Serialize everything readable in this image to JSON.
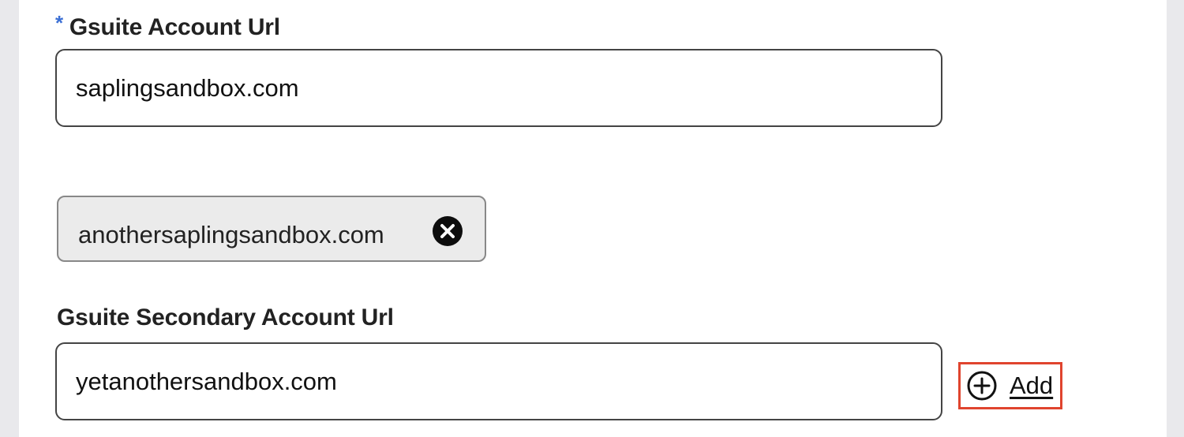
{
  "primary": {
    "required_mark": "*",
    "label": "Gsuite Account Url",
    "value": "saplingsandbox.com"
  },
  "added_urls": [
    {
      "label": "anothersaplingsandbox.com",
      "remove_icon": "close-circle-icon"
    }
  ],
  "secondary": {
    "label": "Gsuite Secondary Account Url",
    "value": "yetanothersandbox.com"
  },
  "add_button": {
    "label": "Add",
    "icon": "plus-circle-icon",
    "highlight_color": "#e0442e"
  },
  "colors": {
    "required_mark": "#3b6fd4"
  }
}
